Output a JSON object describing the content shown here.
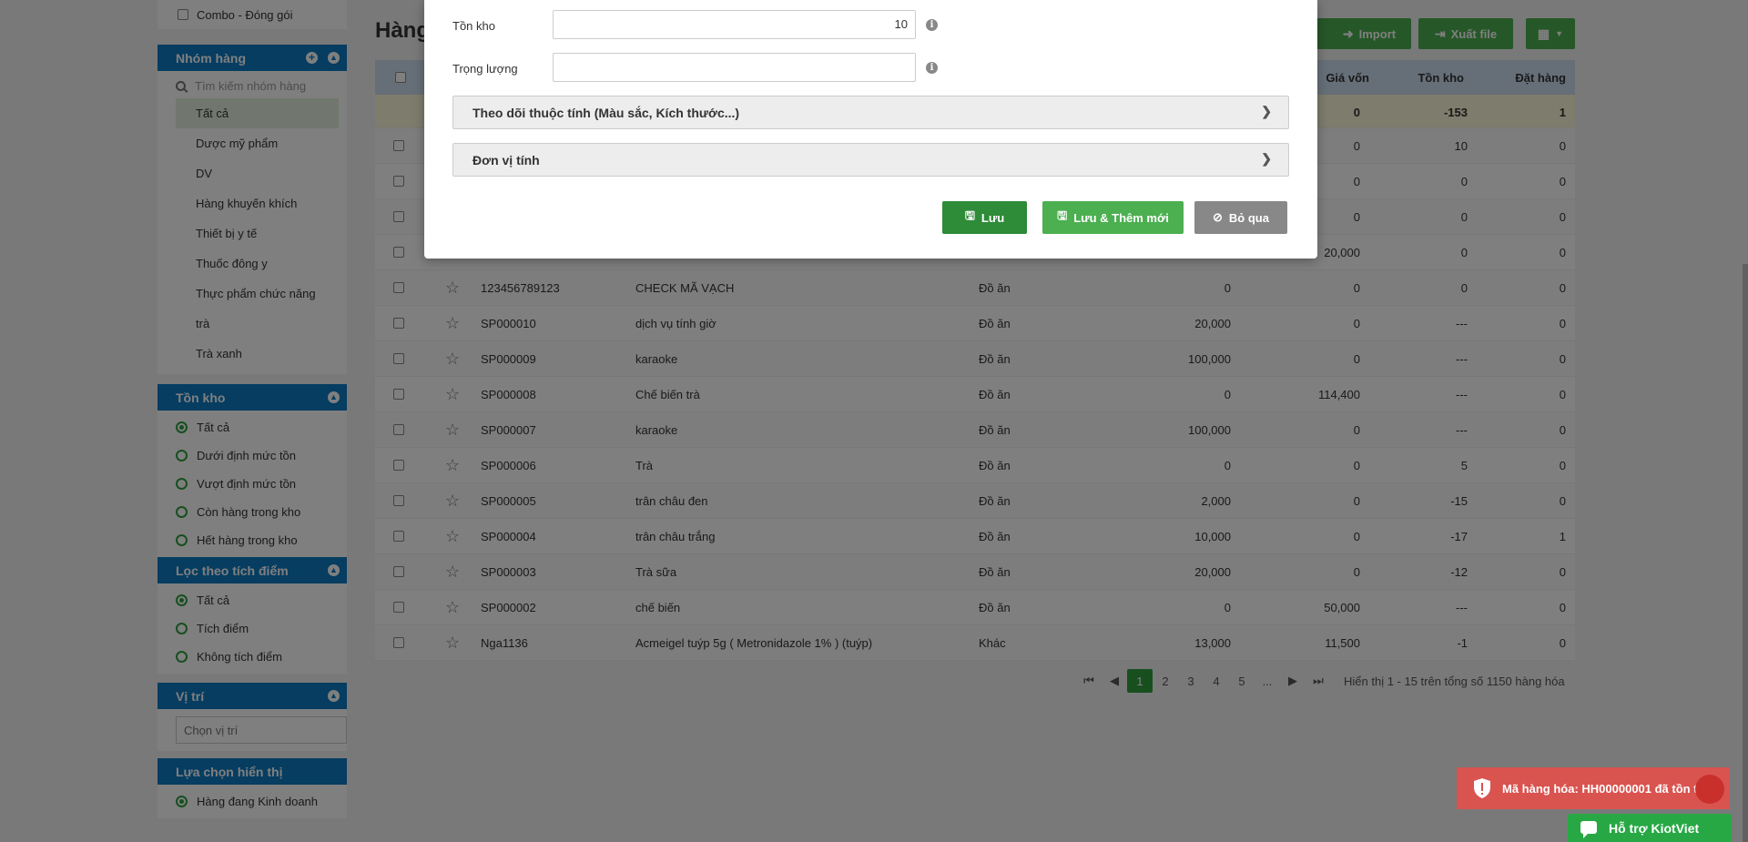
{
  "sidebar": {
    "combo_label": "Combo - Đóng gói",
    "groups": {
      "title": "Nhóm hàng",
      "search_placeholder": "Tìm kiếm nhóm hàng",
      "items": [
        "Tất cả",
        "Dược mỹ phẩm",
        "DV",
        "Hàng khuyến khích",
        "Thiết bị y tế",
        "Thuốc đông y",
        "Thực phẩm chức năng",
        "trà",
        "Trà xanh"
      ]
    },
    "stock": {
      "title": "Tồn kho",
      "options": [
        "Tất cả",
        "Dưới định mức tồn",
        "Vượt định mức tồn",
        "Còn hàng trong kho",
        "Hết hàng trong kho"
      ]
    },
    "points": {
      "title": "Lọc theo tích điểm",
      "options": [
        "Tất cả",
        "Tích điểm",
        "Không tích điểm"
      ]
    },
    "location": {
      "title": "Vị trí",
      "placeholder": "Chọn vị trí"
    },
    "display": {
      "title": "Lựa chọn hiển thị",
      "option": "Hàng đang Kinh doanh"
    }
  },
  "main": {
    "title": "Hàng",
    "toolbar": {
      "import_label": "Import",
      "export_label": "Xuất file"
    },
    "columns": {
      "cost": "Giá vốn",
      "stock": "Tồn kho",
      "ordered": "Đặt hàng"
    },
    "summary": {
      "cost": "0",
      "stock": "-153",
      "ordered": "1"
    },
    "rows": [
      {
        "code": "",
        "name": "",
        "group": "",
        "price": "",
        "cost": "0",
        "stock": "10",
        "ordered": "0"
      },
      {
        "code": "",
        "name": "",
        "group": "",
        "price": "",
        "cost": "0",
        "stock": "0",
        "ordered": "0"
      },
      {
        "code": "",
        "name": "",
        "group": "",
        "price": "",
        "cost": "0",
        "stock": "0",
        "ordered": "0"
      },
      {
        "code": "",
        "name": "",
        "group": "",
        "price": "",
        "cost": "20,000",
        "stock": "0",
        "ordered": "0"
      },
      {
        "code": "123456789123",
        "name": "CHECK MÃ VẠCH",
        "group": "Đồ ăn",
        "price": "0",
        "cost": "0",
        "stock": "0",
        "ordered": "0"
      },
      {
        "code": "SP000010",
        "name": "dịch vụ tính giờ",
        "group": "Đồ ăn",
        "price": "20,000",
        "cost": "0",
        "stock": "---",
        "ordered": "0"
      },
      {
        "code": "SP000009",
        "name": "karaoke",
        "group": "Đồ ăn",
        "price": "100,000",
        "cost": "0",
        "stock": "---",
        "ordered": "0"
      },
      {
        "code": "SP000008",
        "name": "Chế biến trà",
        "group": "Đồ ăn",
        "price": "0",
        "cost": "114,400",
        "stock": "---",
        "ordered": "0"
      },
      {
        "code": "SP000007",
        "name": "karaoke",
        "group": "Đồ ăn",
        "price": "100,000",
        "cost": "0",
        "stock": "---",
        "ordered": "0"
      },
      {
        "code": "SP000006",
        "name": "Trà",
        "group": "Đồ ăn",
        "price": "0",
        "cost": "0",
        "stock": "5",
        "ordered": "0"
      },
      {
        "code": "SP000005",
        "name": "trân châu đen",
        "group": "Đồ ăn",
        "price": "2,000",
        "cost": "0",
        "stock": "-15",
        "ordered": "0"
      },
      {
        "code": "SP000004",
        "name": "trân châu trắng",
        "group": "Đồ ăn",
        "price": "10,000",
        "cost": "0",
        "stock": "-17",
        "ordered": "1"
      },
      {
        "code": "SP000003",
        "name": "Trà sữa",
        "group": "Đồ ăn",
        "price": "20,000",
        "cost": "0",
        "stock": "-12",
        "ordered": "0"
      },
      {
        "code": "SP000002",
        "name": "chế biến",
        "group": "Đồ ăn",
        "price": "0",
        "cost": "50,000",
        "stock": "---",
        "ordered": "0"
      },
      {
        "code": "Nga1136",
        "name": "Acmeigel tuýp 5g ( Metronidazole 1% ) (tuýp)",
        "group": "Khác",
        "price": "13,000",
        "cost": "11,500",
        "stock": "-1",
        "ordered": "0"
      }
    ],
    "pager": {
      "pages": [
        "1",
        "2",
        "3",
        "4",
        "5",
        "..."
      ],
      "info": "Hiển thị 1 - 15 trên tổng số 1150 hàng hóa"
    }
  },
  "modal": {
    "stock_label": "Tồn kho",
    "stock_value": "10",
    "weight_label": "Trọng lượng",
    "weight_value": "",
    "attr_section": "Theo dõi thuộc tính (Màu sắc, Kích thước...)",
    "unit_section": "Đơn vị tính",
    "save_label": "Lưu",
    "save_new_label": "Lưu & Thêm mới",
    "cancel_label": "Bỏ qua"
  },
  "toast": {
    "message": "Mã hàng hóa: HH00000001 đã tồn tại"
  },
  "support": {
    "label": "Hỗ trợ KiotViet"
  },
  "colors": {
    "primary": "#0c7bc3",
    "green": "#4caf50",
    "dark_green": "#2e9e3e",
    "error": "#d9534f"
  }
}
